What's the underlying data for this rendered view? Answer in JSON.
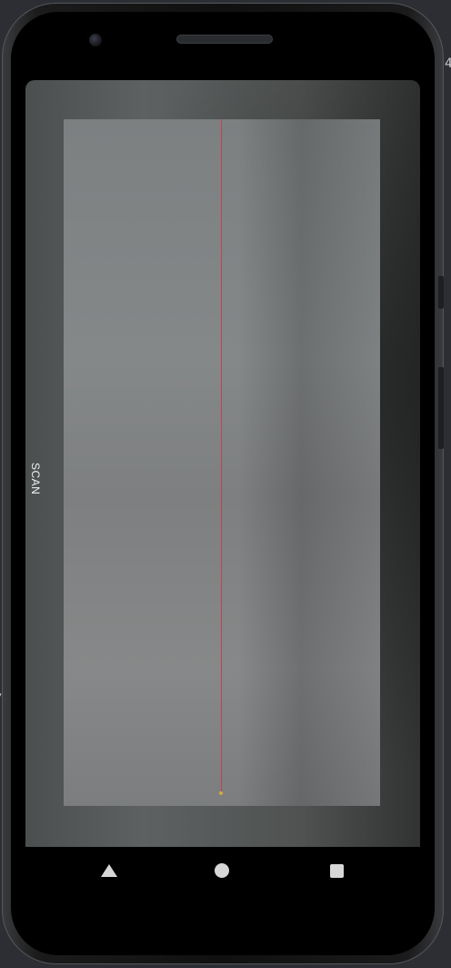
{
  "scanner": {
    "scan_label": "SCAN"
  },
  "device": {
    "edge_top_char": "4",
    "edge_left_char": "’"
  },
  "navigation": {
    "back": "back-icon",
    "home": "home-icon",
    "recents": "recents-icon"
  },
  "colors": {
    "laser": "#c0454a",
    "nav_icons": "#d7d7d7"
  }
}
